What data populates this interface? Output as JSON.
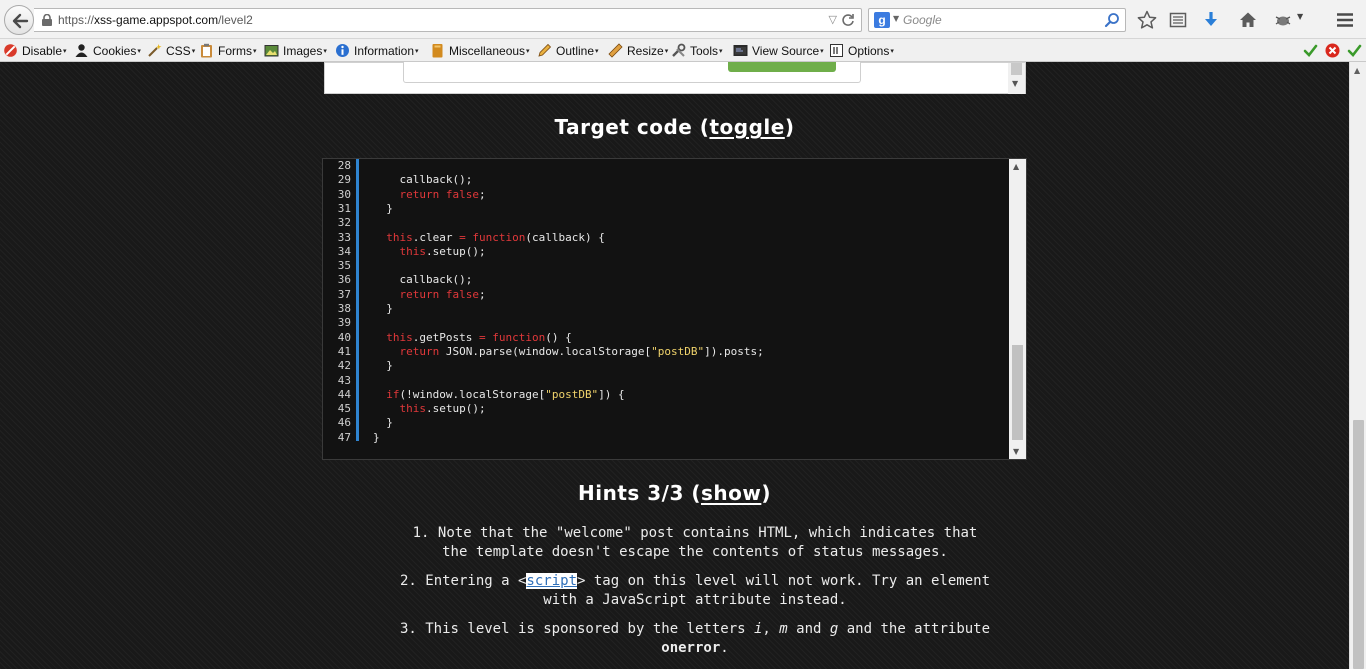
{
  "browser": {
    "url_prefix": "https://",
    "url_host": "xss-game.appspot.com",
    "url_path": "/level2",
    "search_placeholder": "Google"
  },
  "devtoolbar": {
    "items": [
      "Disable",
      "Cookies",
      "CSS",
      "Forms",
      "Images",
      "Information",
      "Miscellaneous",
      "Outline",
      "Resize",
      "Tools",
      "View Source",
      "Options"
    ]
  },
  "target_code": {
    "heading_prefix": "Target code (",
    "heading_link": "toggle",
    "heading_suffix": ")",
    "lines": [
      {
        "n": "28",
        "parts": [
          {
            "t": ""
          }
        ]
      },
      {
        "n": "29",
        "parts": [
          {
            "t": "    callback();"
          }
        ]
      },
      {
        "n": "30",
        "parts": [
          {
            "t": "    "
          },
          {
            "t": "return false",
            "c": "kw"
          },
          {
            "t": ";"
          }
        ]
      },
      {
        "n": "31",
        "parts": [
          {
            "t": "  }"
          }
        ]
      },
      {
        "n": "32",
        "parts": [
          {
            "t": ""
          }
        ]
      },
      {
        "n": "33",
        "parts": [
          {
            "t": "  "
          },
          {
            "t": "this",
            "c": "kw"
          },
          {
            "t": ".clear "
          },
          {
            "t": "=",
            "c": "kw"
          },
          {
            "t": " "
          },
          {
            "t": "function",
            "c": "kw"
          },
          {
            "t": "(callback) {"
          }
        ]
      },
      {
        "n": "34",
        "parts": [
          {
            "t": "    "
          },
          {
            "t": "this",
            "c": "kw"
          },
          {
            "t": ".setup();"
          }
        ]
      },
      {
        "n": "35",
        "parts": [
          {
            "t": ""
          }
        ]
      },
      {
        "n": "36",
        "parts": [
          {
            "t": "    callback();"
          }
        ]
      },
      {
        "n": "37",
        "parts": [
          {
            "t": "    "
          },
          {
            "t": "return false",
            "c": "kw"
          },
          {
            "t": ";"
          }
        ]
      },
      {
        "n": "38",
        "parts": [
          {
            "t": "  }"
          }
        ]
      },
      {
        "n": "39",
        "parts": [
          {
            "t": ""
          }
        ]
      },
      {
        "n": "40",
        "parts": [
          {
            "t": "  "
          },
          {
            "t": "this",
            "c": "kw"
          },
          {
            "t": ".getPosts "
          },
          {
            "t": "=",
            "c": "kw"
          },
          {
            "t": " "
          },
          {
            "t": "function",
            "c": "kw"
          },
          {
            "t": "() {"
          }
        ]
      },
      {
        "n": "41",
        "parts": [
          {
            "t": "    "
          },
          {
            "t": "return",
            "c": "kw"
          },
          {
            "t": " JSON.parse(window.localStorage["
          },
          {
            "t": "\"postDB\"",
            "c": "str"
          },
          {
            "t": "]).posts;"
          }
        ]
      },
      {
        "n": "42",
        "parts": [
          {
            "t": "  }"
          }
        ]
      },
      {
        "n": "43",
        "parts": [
          {
            "t": ""
          }
        ]
      },
      {
        "n": "44",
        "parts": [
          {
            "t": "  "
          },
          {
            "t": "if",
            "c": "kw"
          },
          {
            "t": "(!window.localStorage["
          },
          {
            "t": "\"postDB\"",
            "c": "str"
          },
          {
            "t": "]) {"
          }
        ]
      },
      {
        "n": "45",
        "parts": [
          {
            "t": "    "
          },
          {
            "t": "this",
            "c": "kw"
          },
          {
            "t": ".setup();"
          }
        ]
      },
      {
        "n": "46",
        "parts": [
          {
            "t": "  }"
          }
        ]
      },
      {
        "n": "47",
        "parts": [
          {
            "t": "}"
          }
        ]
      }
    ]
  },
  "hints": {
    "heading_prefix": "Hints 3/3 (",
    "heading_link": "show",
    "heading_suffix": ")",
    "h1_line1": "1. Note that the \"welcome\" post contains HTML, which indicates that",
    "h1_line2": "the template doesn't escape the contents of status messages.",
    "h2_pre": "2. Entering a <",
    "h2_sel": "script",
    "h2_post": "> tag on this level will not work. Try an element",
    "h2_line2": "with a JavaScript attribute instead.",
    "h3_pre": "3. This level is sponsored by the letters ",
    "h3_i": "i",
    "h3_comma": ", ",
    "h3_m": "m",
    "h3_and": " and ",
    "h3_g": "g",
    "h3_post": " and the attribute",
    "h3_bold": "onerror",
    "h3_end": "."
  },
  "colors": {
    "keyword": "#e0383a",
    "string": "#f0d36b",
    "gutter_accent": "#2f84d0",
    "selection": "#2f6fb8"
  }
}
